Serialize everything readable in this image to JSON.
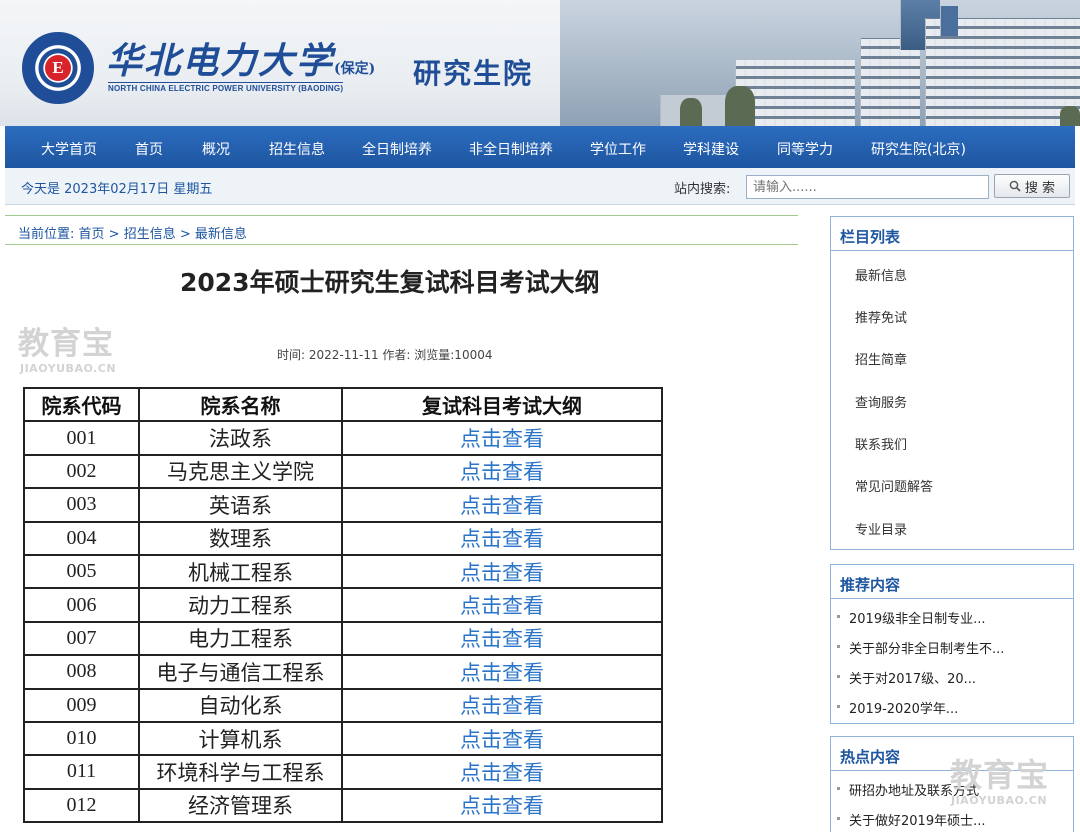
{
  "header": {
    "university_cn": "华北电力大学",
    "university_paren": "(保定)",
    "university_en": "NORTH CHINA ELECTRIC POWER UNIVERSITY (BAODING)",
    "site_title": "研究生院",
    "logo_letter": "E",
    "brand_color": "#1f4d97"
  },
  "nav": {
    "items": [
      "大学首页",
      "首页",
      "概况",
      "招生信息",
      "全日制培养",
      "非全日制培养",
      "学位工作",
      "学科建设",
      "同等学力",
      "研究生院(北京)"
    ]
  },
  "infobar": {
    "today": "今天是 2023年02月17日 星期五",
    "search_label": "站内搜索:",
    "search_placeholder": "请输入......",
    "search_button": "搜 索"
  },
  "breadcrumb": {
    "prefix": "当前位置: ",
    "items": [
      "首页",
      "招生信息",
      "最新信息"
    ],
    "separator": " > "
  },
  "article": {
    "title": "2023年硕士研究生复试科目考试大纲",
    "meta": "时间: 2022-11-11   作者:   浏览量:10004"
  },
  "table": {
    "headers": [
      "院系代码",
      "院系名称",
      "复试科目考试大纲"
    ],
    "rows": [
      {
        "code": "001",
        "name": "法政系",
        "link": "点击查看"
      },
      {
        "code": "002",
        "name": "马克思主义学院",
        "link": "点击查看"
      },
      {
        "code": "003",
        "name": "英语系",
        "link": "点击查看"
      },
      {
        "code": "004",
        "name": "数理系",
        "link": "点击查看"
      },
      {
        "code": "005",
        "name": "机械工程系",
        "link": "点击查看"
      },
      {
        "code": "006",
        "name": "动力工程系",
        "link": "点击查看"
      },
      {
        "code": "007",
        "name": "电力工程系",
        "link": "点击查看"
      },
      {
        "code": "008",
        "name": "电子与通信工程系",
        "link": "点击查看"
      },
      {
        "code": "009",
        "name": "自动化系",
        "link": "点击查看"
      },
      {
        "code": "010",
        "name": "计算机系",
        "link": "点击查看"
      },
      {
        "code": "011",
        "name": "环境科学与工程系",
        "link": "点击查看"
      },
      {
        "code": "012",
        "name": "经济管理系",
        "link": "点击查看"
      }
    ]
  },
  "sidebar": {
    "columns_title": "栏目列表",
    "columns": [
      "最新信息",
      "推荐免试",
      "招生简章",
      "查询服务",
      "联系我们",
      "常见问题解答",
      "专业目录"
    ],
    "recommended_title": "推荐内容",
    "recommended": [
      "2019级非全日制专业...",
      "关于部分非全日制考生不...",
      "关于对2017级、20...",
      "2019-2020学年..."
    ],
    "hot_title": "热点内容",
    "hot": [
      "研招办地址及联系方式",
      "关于做好2019年硕士..."
    ]
  },
  "watermark": {
    "text_cn": "教育宝",
    "text_en": "JIAOYUBAO.CN"
  },
  "colors": {
    "nav_blue": "#1e56a0",
    "link_blue": "#2a74c9",
    "border_green": "#9fc98f",
    "side_border": "#8fb3d9"
  }
}
